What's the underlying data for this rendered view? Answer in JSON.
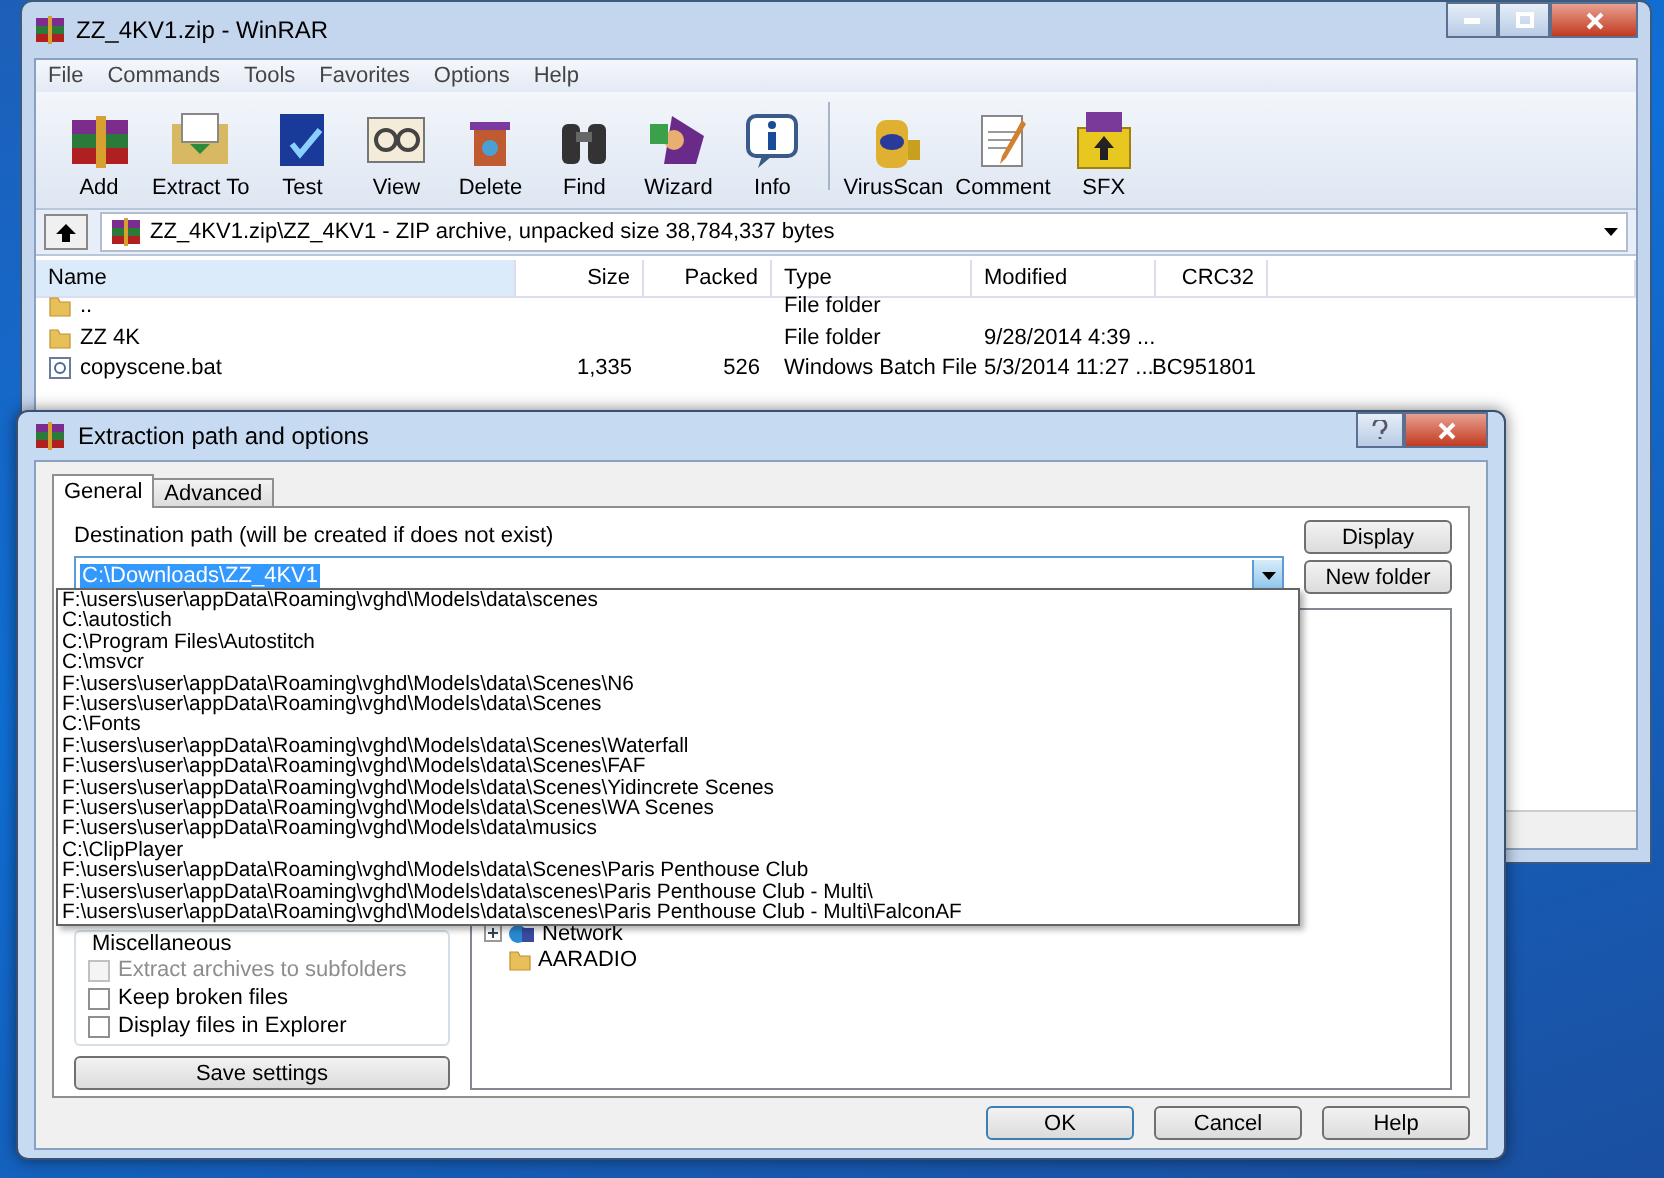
{
  "main_window": {
    "title": "ZZ_4KV1.zip - WinRAR",
    "menu": [
      "File",
      "Commands",
      "Tools",
      "Favorites",
      "Options",
      "Help"
    ],
    "toolbar": [
      {
        "kind": "add",
        "label": "Add"
      },
      {
        "kind": "extract",
        "label": "Extract To"
      },
      {
        "kind": "test",
        "label": "Test"
      },
      {
        "kind": "view",
        "label": "View"
      },
      {
        "kind": "delete",
        "label": "Delete"
      },
      {
        "kind": "find",
        "label": "Find"
      },
      {
        "kind": "wizard",
        "label": "Wizard"
      },
      {
        "kind": "info",
        "label": "Info"
      },
      {
        "kind": "virus",
        "label": "VirusScan"
      },
      {
        "kind": "comment",
        "label": "Comment"
      },
      {
        "kind": "sfx",
        "label": "SFX"
      }
    ],
    "address": "ZZ_4KV1.zip\\ZZ_4KV1 - ZIP archive, unpacked size 38,784,337 bytes",
    "table": {
      "columns": [
        "Name",
        "Size",
        "Packed",
        "Type",
        "Modified",
        "CRC32"
      ],
      "rows": [
        {
          "kind": "folder",
          "cells": [
            "..",
            "",
            "",
            "File folder",
            "",
            ""
          ]
        },
        {
          "kind": "folder",
          "cells": [
            "ZZ 4K",
            "",
            "",
            "File folder",
            "9/28/2014 4:39 ...",
            ""
          ]
        },
        {
          "kind": "file",
          "cells": [
            "copyscene.bat",
            "1,335",
            "526",
            "Windows Batch File",
            "5/3/2014 11:27 ...",
            "BC951801"
          ]
        }
      ]
    }
  },
  "dialog": {
    "title": "Extraction path and options",
    "tabs": [
      {
        "label": "General",
        "selected": true
      },
      {
        "label": "Advanced",
        "selected": false
      }
    ],
    "destination_label": "Destination path (will be created if does not exist)",
    "destination_value": "C:\\Downloads\\ZZ_4KV1",
    "side_buttons": [
      "Display",
      "New folder"
    ],
    "dropdown_items": [
      "F:\\users\\user\\appData\\Roaming\\vghd\\Models\\data\\scenes",
      "C:\\autostich",
      "C:\\Program Files\\Autostitch",
      "C:\\msvcr",
      "F:\\users\\user\\appData\\Roaming\\vghd\\Models\\data\\Scenes\\N6",
      "F:\\users\\user\\appData\\Roaming\\vghd\\Models\\data\\Scenes",
      "C:\\Fonts",
      "F:\\users\\user\\appData\\Roaming\\vghd\\Models\\data\\Scenes\\Waterfall",
      "F:\\users\\user\\appData\\Roaming\\vghd\\Models\\data\\Scenes\\FAF",
      "F:\\users\\user\\appData\\Roaming\\vghd\\Models\\data\\Scenes\\Yidincrete Scenes",
      "F:\\users\\user\\appData\\Roaming\\vghd\\Models\\data\\Scenes\\WA Scenes",
      "F:\\users\\user\\appData\\Roaming\\vghd\\Models\\data\\musics",
      "C:\\ClipPlayer",
      "F:\\users\\user\\appData\\Roaming\\vghd\\Models\\data\\Scenes\\Paris Penthouse Club",
      "F:\\users\\user\\appData\\Roaming\\vghd\\Models\\data\\scenes\\Paris Penthouse Club - Multi\\",
      "F:\\users\\user\\appData\\Roaming\\vghd\\Models\\data\\scenes\\Paris Penthouse Club - Multi\\FalconAF"
    ],
    "group_label": "Miscellaneous",
    "options": [
      {
        "label": "Extract archives to subfolders",
        "checked": false,
        "disabled": true
      },
      {
        "label": "Keep broken files",
        "checked": false,
        "disabled": false
      },
      {
        "label": "Display files in Explorer",
        "checked": false,
        "disabled": false
      }
    ],
    "save_button": "Save settings",
    "tree": [
      {
        "kind": "network",
        "label": "Network",
        "expanded": false
      },
      {
        "kind": "folder",
        "label": "AARADIO"
      }
    ],
    "buttons": [
      "OK",
      "Cancel",
      "Help"
    ]
  }
}
